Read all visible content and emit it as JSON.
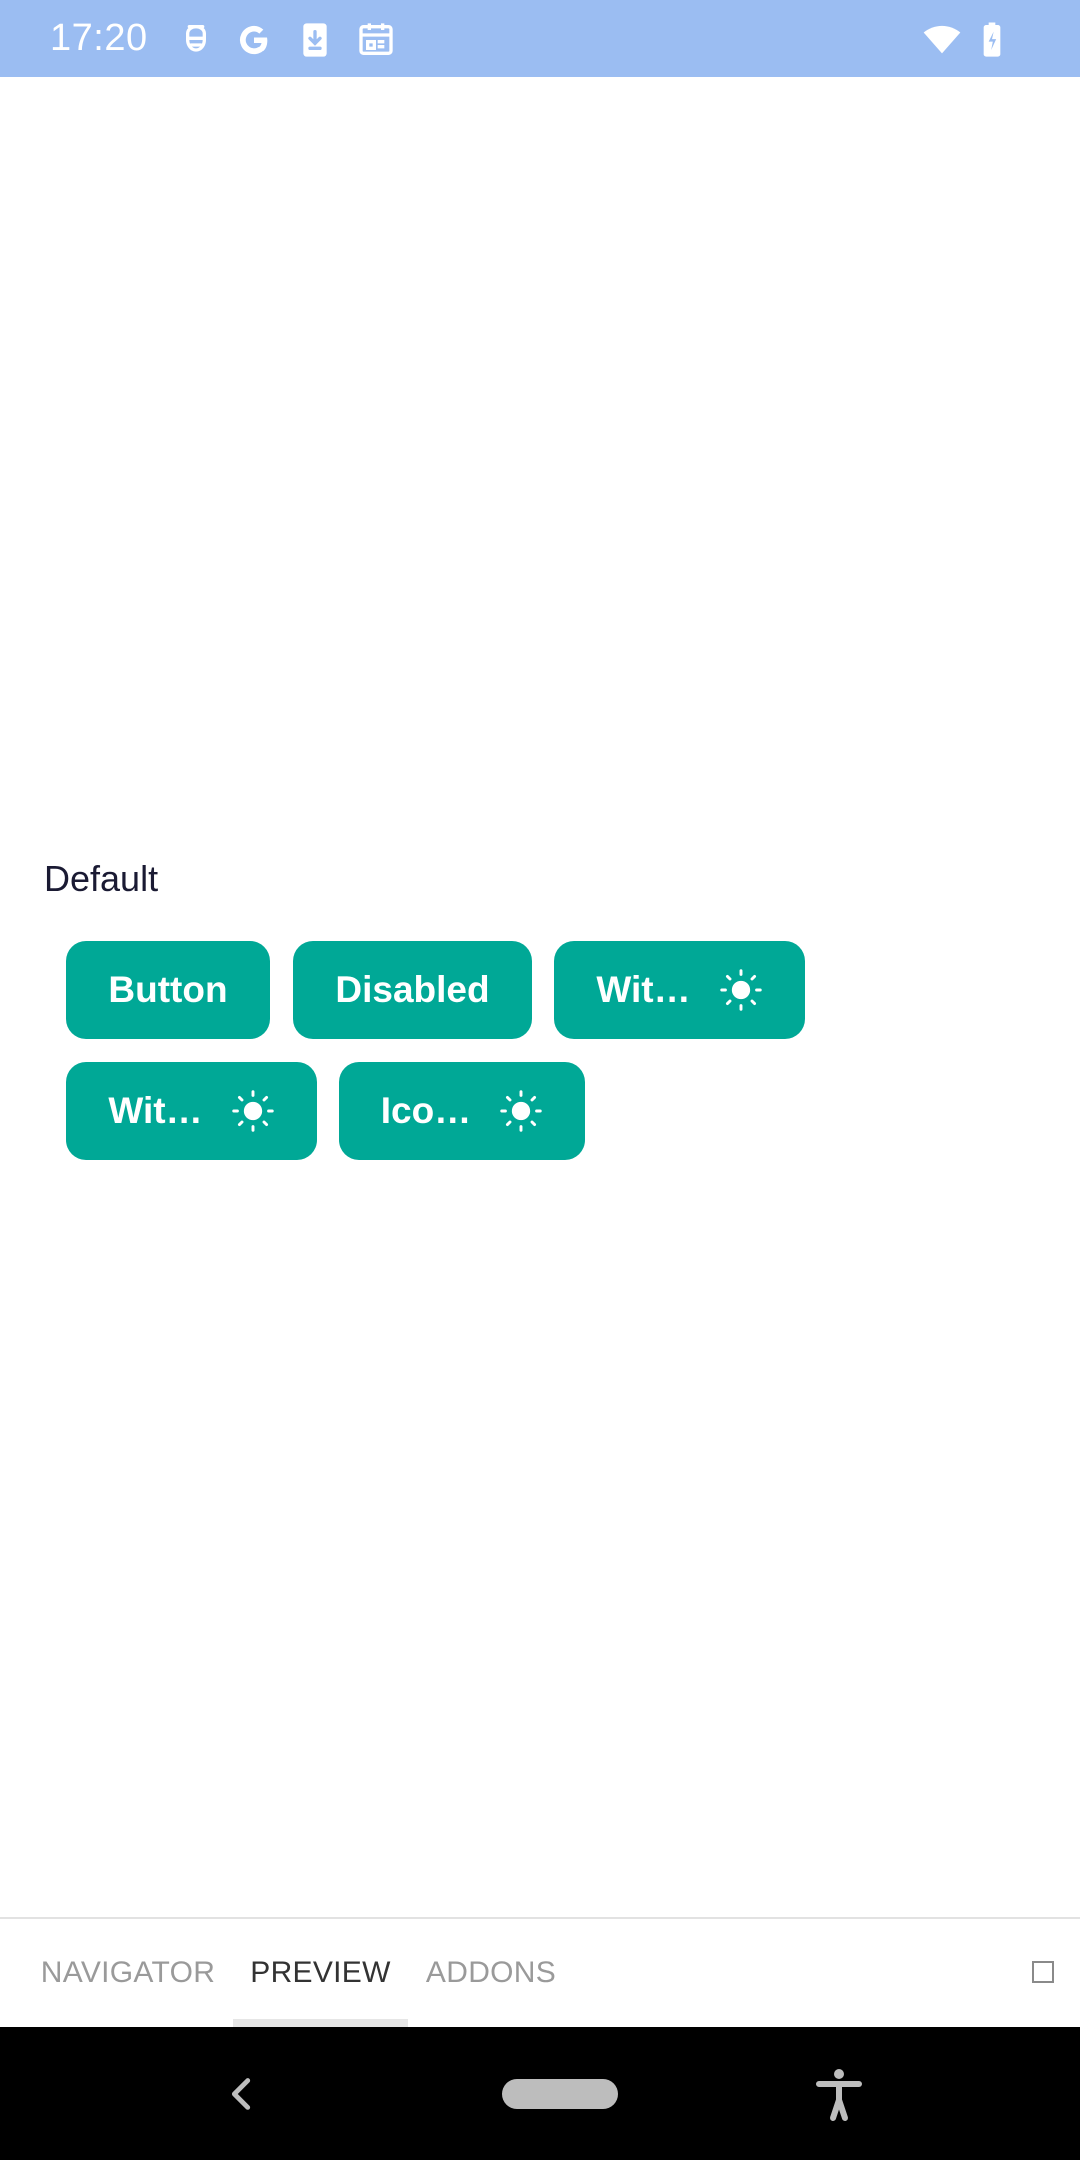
{
  "status_bar": {
    "time": "17:20",
    "icons": [
      "notification-icon",
      "google-icon",
      "download-icon",
      "calendar-icon",
      "wifi-icon",
      "battery-charging-icon"
    ]
  },
  "main": {
    "section_title": "Default",
    "buttons": [
      {
        "label": "Button",
        "icon": null
      },
      {
        "label": "Disabled",
        "icon": null
      },
      {
        "label": "Wit…",
        "icon": "sun-icon"
      },
      {
        "label": "Wit…",
        "icon": "sun-icon"
      },
      {
        "label": "Ico…",
        "icon": "sun-icon"
      }
    ],
    "accent_color": "#00a896"
  },
  "bottom_tabs": {
    "tabs": [
      {
        "label": "NAVIGATOR",
        "active": false
      },
      {
        "label": "PREVIEW",
        "active": true
      },
      {
        "label": "ADDONS",
        "active": false
      }
    ]
  },
  "nav_bar": {
    "icons": [
      "back-icon",
      "home-pill",
      "accessibility-icon"
    ]
  },
  "colors": {
    "status_bar": "#9bbdf2",
    "button": "#00a896",
    "nav_bar": "#000000"
  }
}
